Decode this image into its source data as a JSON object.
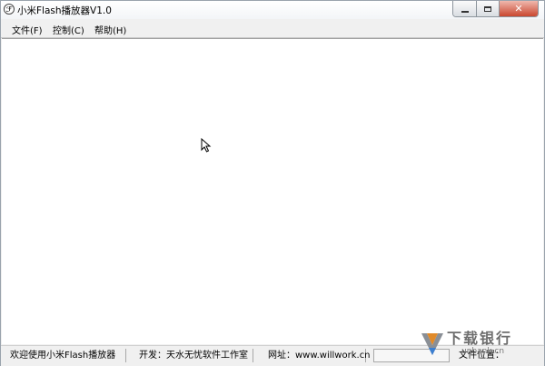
{
  "window": {
    "title": "小米Flash播放器V1.0",
    "app_icon_glyph": "ℱ"
  },
  "window_controls": {
    "minimize_icon": "minimize-icon",
    "maximize_icon": "maximize-icon",
    "close_icon": "close-icon",
    "close_glyph": "✕",
    "close_color": "#c9462f"
  },
  "menubar": {
    "items": [
      {
        "label": "文件(F)"
      },
      {
        "label": "控制(C)"
      },
      {
        "label": "帮助(H)"
      }
    ]
  },
  "statusbar": {
    "welcome": "欢迎使用小米Flash播放器",
    "developer": "开发：天水无忧软件工作室",
    "website": "网址：www.willwork.cn",
    "file_position": "文件位置："
  },
  "watermark": {
    "brand": "下载银行",
    "domain_fragment": "unbank.cn"
  },
  "colors": {
    "window_bg": "#f0f0f0",
    "client_bg": "#ffffff"
  }
}
